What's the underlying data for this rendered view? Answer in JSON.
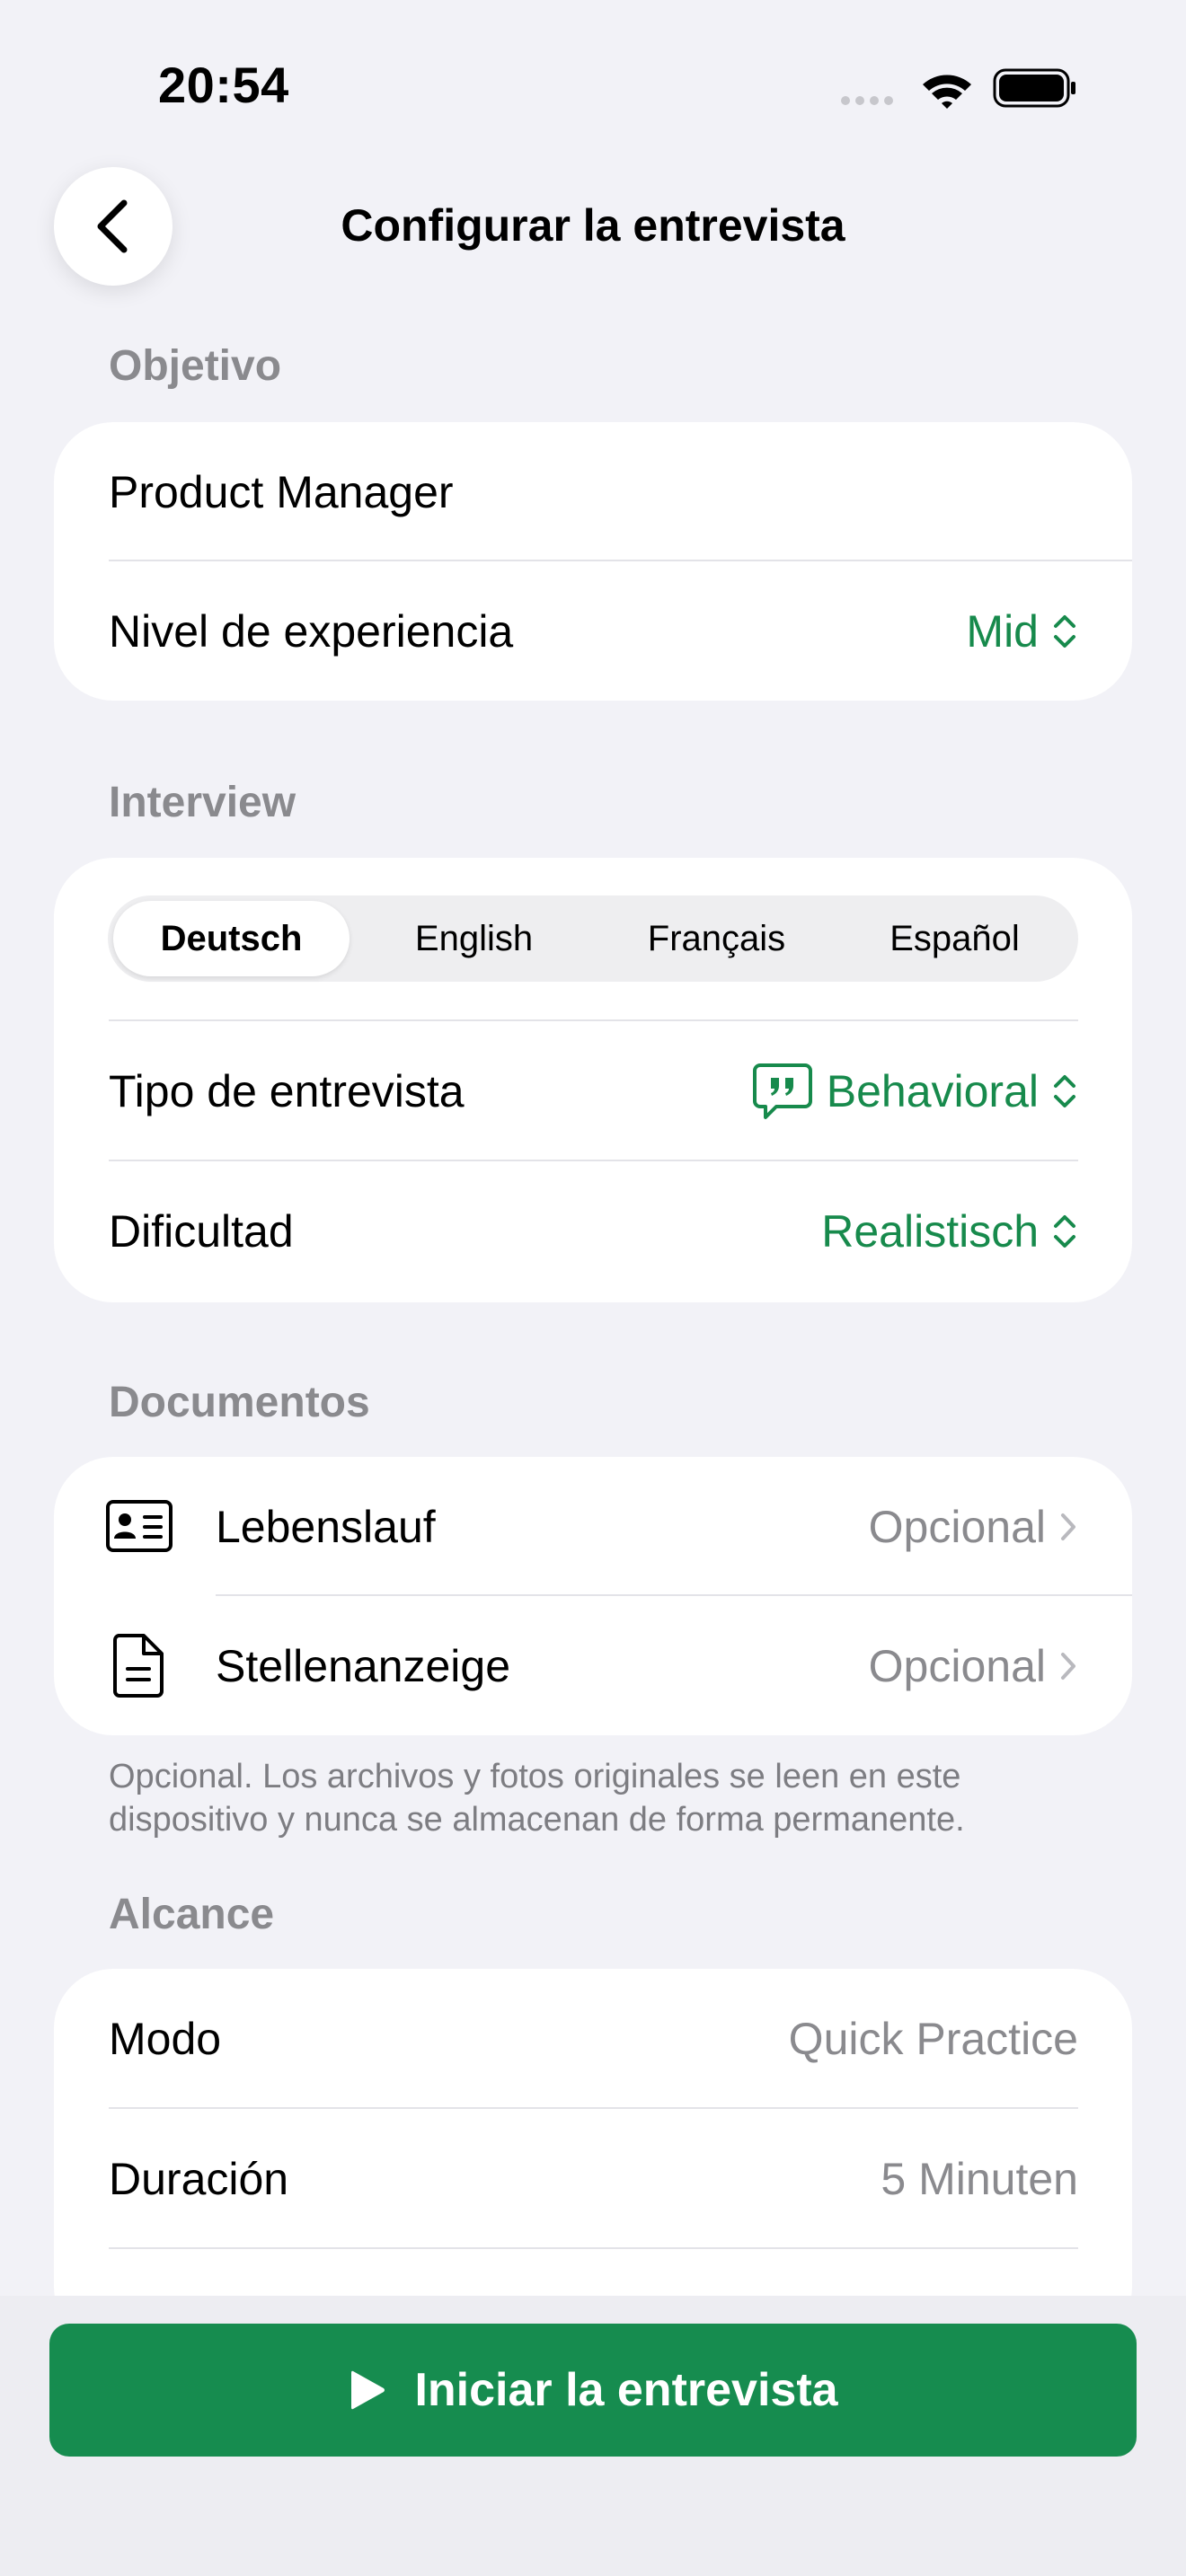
{
  "status_bar": {
    "time": "20:54"
  },
  "nav": {
    "title": "Configurar la entrevista"
  },
  "objective": {
    "header": "Objetivo",
    "role": "Product Manager",
    "experience_label": "Nivel de experiencia",
    "experience_value": "Mid"
  },
  "interview": {
    "header": "Interview",
    "languages": [
      "Deutsch",
      "English",
      "Français",
      "Español"
    ],
    "selected_language": "Deutsch",
    "type_label": "Tipo de entrevista",
    "type_value": "Behavioral",
    "difficulty_label": "Dificultad",
    "difficulty_value": "Realistisch"
  },
  "documents": {
    "header": "Documentos",
    "items": [
      {
        "label": "Lebenslauf",
        "value": "Opcional",
        "icon": "id-card-icon"
      },
      {
        "label": "Stellenanzeige",
        "value": "Opcional",
        "icon": "document-icon"
      }
    ],
    "footnote": "Opcional. Los archivos y fotos originales se leen en este dispositivo y nunca se almacenan de forma permanente."
  },
  "scope": {
    "header": "Alcance",
    "mode_label": "Modo",
    "mode_value": "Quick Practice",
    "duration_label": "Duración",
    "duration_value": "5 Minuten"
  },
  "start_button": {
    "label": "Iniciar la entrevista",
    "icon": "play-icon"
  },
  "colors": {
    "accent": "#168C4F",
    "background": "#F2F2F7",
    "secondary_text": "#8A8A8E"
  }
}
